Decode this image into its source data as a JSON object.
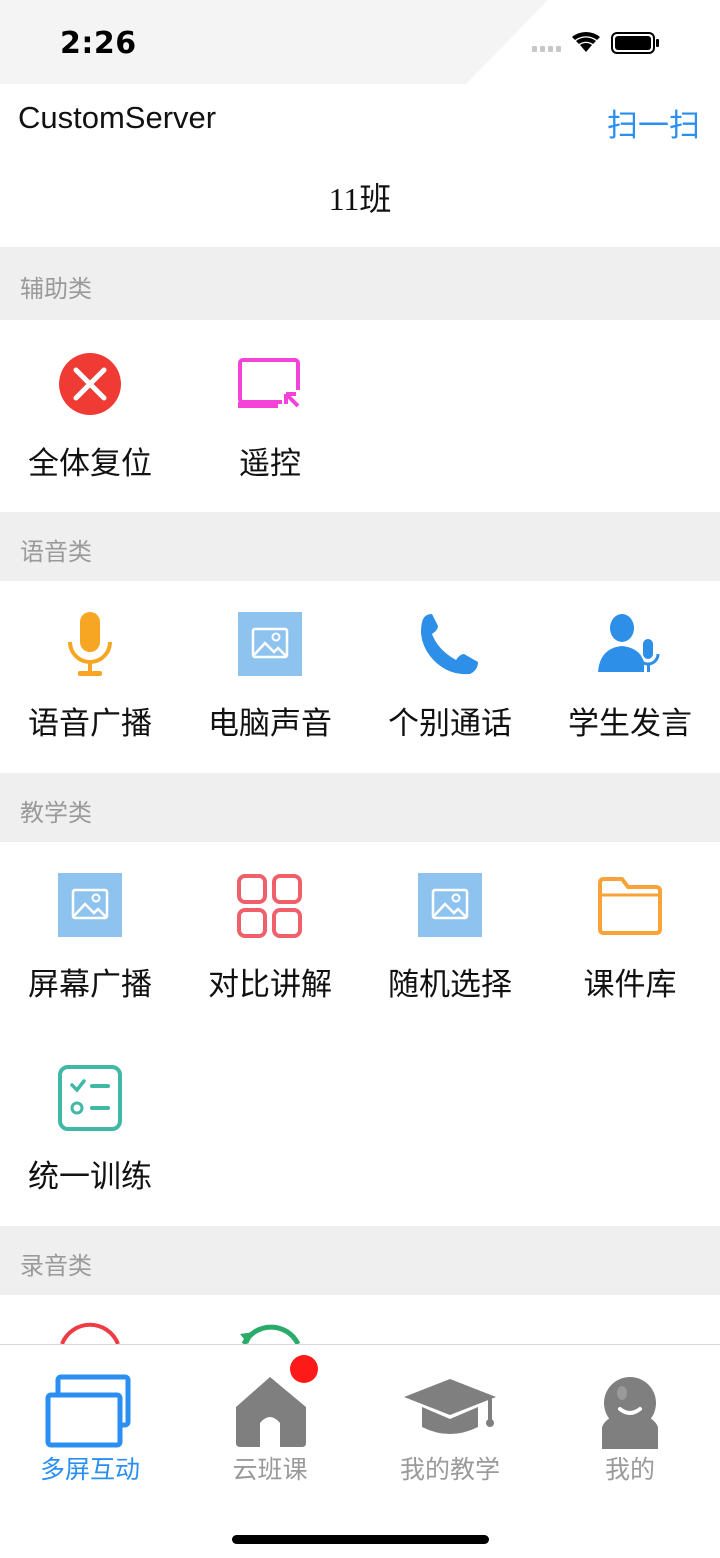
{
  "status_bar": {
    "time": "2:26"
  },
  "header": {
    "server_name": "CustomServer",
    "scan_label": "扫一扫",
    "class_title": "11班"
  },
  "sections": [
    {
      "title": "辅助类",
      "items": [
        {
          "label": "全体复位",
          "icon": "close-circle-icon"
        },
        {
          "label": "遥控",
          "icon": "remote-screen-icon"
        }
      ]
    },
    {
      "title": "语音类",
      "items": [
        {
          "label": "语音广播",
          "icon": "microphone-icon"
        },
        {
          "label": "电脑声音",
          "icon": "image-placeholder-icon"
        },
        {
          "label": "个别通话",
          "icon": "phone-icon"
        },
        {
          "label": "学生发言",
          "icon": "student-speak-icon"
        }
      ]
    },
    {
      "title": "教学类",
      "items": [
        {
          "label": "屏幕广播",
          "icon": "image-placeholder-icon"
        },
        {
          "label": "对比讲解",
          "icon": "grid-icon"
        },
        {
          "label": "随机选择",
          "icon": "image-placeholder-icon"
        },
        {
          "label": "课件库",
          "icon": "folder-icon"
        },
        {
          "label": "统一训练",
          "icon": "checklist-icon"
        }
      ]
    },
    {
      "title": "录音类",
      "items": []
    }
  ],
  "tabs": [
    {
      "label": "多屏互动",
      "icon": "multi-screen-icon",
      "active": true
    },
    {
      "label": "云班课",
      "icon": "house-icon",
      "active": false,
      "badge": true
    },
    {
      "label": "我的教学",
      "icon": "graduation-cap-icon",
      "active": false
    },
    {
      "label": "我的",
      "icon": "user-avatar-icon",
      "active": false
    }
  ],
  "colors": {
    "accent": "#2a8ff0",
    "inactive": "#9a9a9a",
    "section_bg": "#efefef",
    "badge": "#ff1a1a"
  }
}
